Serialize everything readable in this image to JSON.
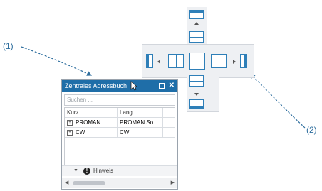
{
  "callouts": {
    "one": "(1)",
    "two": "(2)"
  },
  "panel": {
    "title": "Zentrales Adressbuch",
    "search_placeholder": "Suchen ...",
    "columns": [
      "Kurz",
      "Lang"
    ],
    "rows": [
      {
        "kurz": "PROMAN",
        "lang": "PROMAN So..."
      },
      {
        "kurz": "CW",
        "lang": "CW"
      }
    ],
    "footer_label": "Hinweis",
    "close_glyph": "✕",
    "info_glyph": "!"
  },
  "colors": {
    "title_bar": "#1f6ea8",
    "accent": "#2e7fb8",
    "callout": "#2e6e9e"
  },
  "icons": [
    "pin-icon",
    "close-icon",
    "mouse-cursor-icon",
    "expand-icon",
    "info-icon",
    "dock-guide-icons"
  ]
}
